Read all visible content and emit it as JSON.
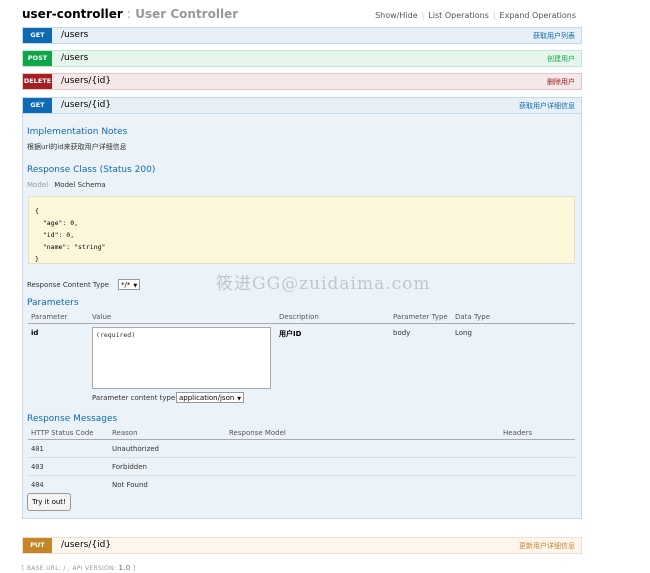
{
  "header": {
    "resource": "user-controller",
    "separator": ":",
    "description": "User Controller",
    "links": [
      "Show/Hide",
      "List Operations",
      "Expand Operations"
    ]
  },
  "operations": [
    {
      "method": "GET",
      "path": "/users",
      "summary": "获取用户列表"
    },
    {
      "method": "POST",
      "path": "/users",
      "summary": "创建用户"
    },
    {
      "method": "DELETE",
      "path": "/users/{id}",
      "summary": "删除用户"
    },
    {
      "method": "GET",
      "path": "/users/{id}",
      "summary": "获取用户详细信息"
    }
  ],
  "put_operation": {
    "method": "PUT",
    "path": "/users/{id}",
    "summary": "更新用户详细信息"
  },
  "detail": {
    "impl_title": "Implementation Notes",
    "impl_text": "根据url的id来获取用户详细信息",
    "response_class_title": "Response Class (Status 200)",
    "tab_model": "Model",
    "tab_schema": "Model Schema",
    "schema_lines": [
      "{",
      "  \"age\": 0,",
      "  \"id\": 0,",
      "  \"name\": \"string\"",
      "}"
    ],
    "content_type_label": "Response Content Type",
    "content_type_value": "*/*",
    "parameters_title": "Parameters",
    "param_headers": [
      "Parameter",
      "Value",
      "Description",
      "Parameter Type",
      "Data Type"
    ],
    "param": {
      "name": "id",
      "placeholder": "(required)",
      "description": "用户ID",
      "type": "body",
      "data_type": "Long"
    },
    "param_content_type_label": "Parameter content type:",
    "param_content_type_value": "application/json",
    "messages_title": "Response Messages",
    "message_headers": [
      "HTTP Status Code",
      "Reason",
      "Response Model",
      "Headers"
    ],
    "messages": [
      {
        "code": "401",
        "reason": "Unauthorized"
      },
      {
        "code": "403",
        "reason": "Forbidden"
      },
      {
        "code": "404",
        "reason": "Not Found"
      }
    ],
    "try_button": "Try it out!"
  },
  "footer": {
    "base_url_label": "[ BASE URL: / , API VERSION:",
    "version": "1.0",
    "close": "]"
  },
  "watermark": "筱进GG@zuidaima.com"
}
